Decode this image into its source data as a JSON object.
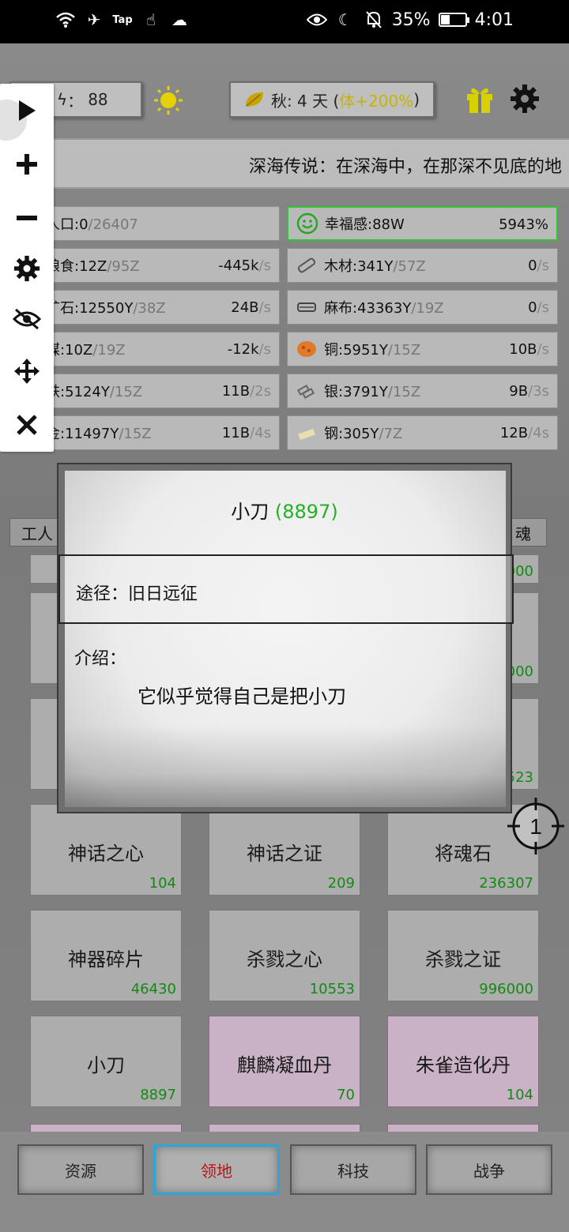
{
  "status_bar": {
    "tap_label": "Tap",
    "battery": "35%",
    "battery_level": 0.35,
    "time": "4:01"
  },
  "top": {
    "stamina_label": "体力",
    "stamina_value": "88",
    "season_text": "秋: 4 天 (",
    "season_bonus": "体+200%",
    "season_close": ")"
  },
  "ticker": {
    "text": "深海传说：在深海中，在那深不见底的地"
  },
  "resources": [
    {
      "name": "人口:0",
      "max": "/26407",
      "rate": "",
      "unit": "",
      "icon": "people-icon"
    },
    {
      "name": "幸福感:88W",
      "max": "",
      "rate": "5943%",
      "unit": "",
      "icon": "smile-icon"
    },
    {
      "name": "粮食:12Z",
      "max": "/95Z",
      "rate": "-445k",
      "unit": "/s",
      "icon": "grain-icon"
    },
    {
      "name": "木材:341Y",
      "max": "/57Z",
      "rate": "0",
      "unit": "/s",
      "icon": "wood-icon"
    },
    {
      "name": "矿石:12550Y",
      "max": "/38Z",
      "rate": "24B",
      "unit": "/s",
      "icon": "ore-icon"
    },
    {
      "name": "麻布:43363Y",
      "max": "/19Z",
      "rate": "0",
      "unit": "/s",
      "icon": "linen-icon"
    },
    {
      "name": "煤:10Z",
      "max": "/19Z",
      "rate": "-12k",
      "unit": "/s",
      "icon": "coal-icon"
    },
    {
      "name": "铜:5951Y",
      "max": "/15Z",
      "rate": "10B",
      "unit": "/s",
      "icon": "copper-icon"
    },
    {
      "name": "铁:5124Y",
      "max": "/15Z",
      "rate": "11B",
      "unit": "/2s",
      "icon": "iron-icon"
    },
    {
      "name": "银:3791Y",
      "max": "/15Z",
      "rate": "9B",
      "unit": "/3s",
      "icon": "silver-icon"
    },
    {
      "name": "金:11497Y",
      "max": "/15Z",
      "rate": "11B",
      "unit": "/4s",
      "icon": "gold-icon"
    },
    {
      "name": "钢:305Y",
      "max": "/7Z",
      "rate": "12B",
      "unit": "/4s",
      "icon": "steel-icon"
    }
  ],
  "tabs_partial": {
    "left": "工人",
    "right": "魂"
  },
  "grid_partial_counts": [
    "000",
    "000",
    "523"
  ],
  "items": [
    {
      "name": "神话之心",
      "count": "104",
      "special": false
    },
    {
      "name": "神话之证",
      "count": "209",
      "special": false
    },
    {
      "name": "将魂石",
      "count": "236307",
      "special": false
    },
    {
      "name": "神器碎片",
      "count": "46430",
      "special": false
    },
    {
      "name": "杀戮之心",
      "count": "10553",
      "special": false
    },
    {
      "name": "杀戮之证",
      "count": "996000",
      "special": false
    },
    {
      "name": "小刀",
      "count": "8897",
      "special": false
    },
    {
      "name": "麒麟凝血丹",
      "count": "70",
      "special": true
    },
    {
      "name": "朱雀造化丹",
      "count": "104",
      "special": true
    }
  ],
  "nav": [
    "资源",
    "领地",
    "科技",
    "战争"
  ],
  "popup": {
    "title": "小刀",
    "count": "(8897)",
    "source": "途径：旧日远征",
    "desc_label": "介绍：",
    "desc": "它似乎觉得自己是把小刀"
  },
  "crosshair_label": "1",
  "colors": {
    "green_count": "#128a12",
    "active_nav_border": "#2aa7d8",
    "active_nav_text": "#c01010",
    "happy_border": "#31c431",
    "bonus_yellow": "#c8b400"
  }
}
